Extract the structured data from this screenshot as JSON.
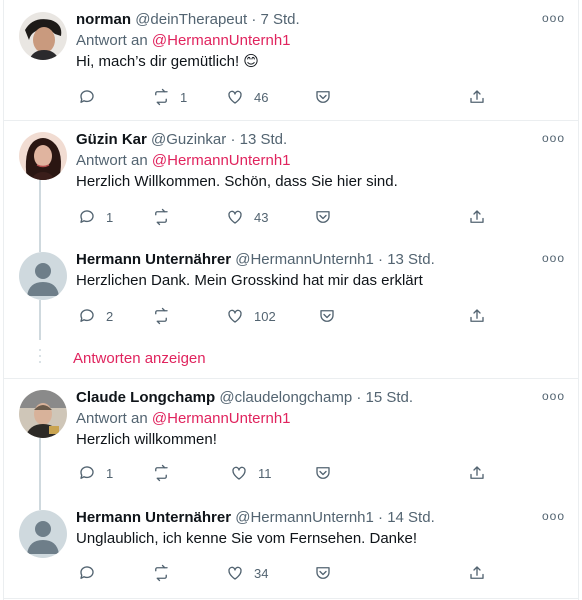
{
  "tweets": [
    {
      "name": "norman",
      "handle": "@deinTherapeut",
      "time": "7 Std.",
      "reply_prefix": "Antwort an",
      "reply_to": "@HermannUnternh1",
      "text": "Hi, mach’s dir gemütlich! 😊",
      "replies": "",
      "retweets": "1",
      "likes": "46"
    },
    {
      "name": "Güzin Kar",
      "handle": "@Guzinkar",
      "time": "13 Std.",
      "reply_prefix": "Antwort an",
      "reply_to": "@HermannUnternh1",
      "text": "Herzlich Willkommen. Schön, dass Sie hier sind.",
      "replies": "1",
      "retweets": "",
      "likes": "43"
    },
    {
      "name": "Hermann Unternährer",
      "handle": "@HermannUnternh1",
      "time": "13 Std.",
      "text": "Herzlichen Dank. Mein Grosskind hat mir das erklärt",
      "replies": "2",
      "retweets": "",
      "likes": "102"
    },
    {
      "name": "Claude Longchamp",
      "handle": "@claudelongchamp",
      "time": "15 Std.",
      "reply_prefix": "Antwort an",
      "reply_to": "@HermannUnternh1",
      "text": "Herzlich willkommen!",
      "replies": "1",
      "retweets": "",
      "likes": "11"
    },
    {
      "name": "Hermann Unternährer",
      "handle": "@HermannUnternh1",
      "time": "14 Std.",
      "text": "Unglaublich, ich kenne Sie vom Fernsehen. Danke!",
      "replies": "",
      "retweets": "",
      "likes": "34"
    }
  ],
  "show_replies_label": "Antworten anzeigen",
  "separator_dot": "·",
  "more_label": "ooo",
  "colors": {
    "accent": "#e0245e",
    "muted": "#536471",
    "line": "#cfd9de",
    "border": "#ebeef0"
  },
  "icons": [
    "reply-icon",
    "retweet-icon",
    "like-icon",
    "pocket-icon",
    "share-icon",
    "more-icon"
  ]
}
